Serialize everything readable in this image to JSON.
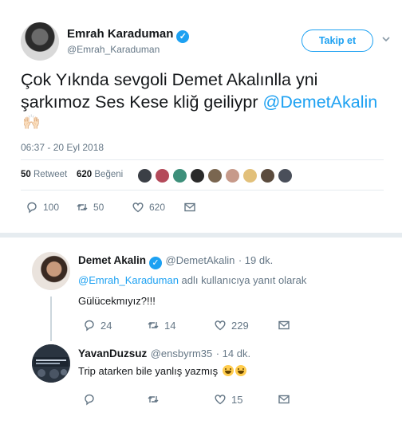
{
  "tweet": {
    "author_name": "Emrah Karaduman",
    "author_handle": "@Emrah_Karaduman",
    "follow_label": "Takip et",
    "text_line1": "Çok Yıknda sevgoli Demet Akalınlla yni",
    "text_line2": "şarkımoz Ses Kese kliğ geiliypr ",
    "mention": "@DemetAkalin",
    "emoji": "🙌🏻",
    "timestamp": "06:37 - 20 Eyl 2018",
    "retweet_count": "50",
    "retweet_label": "Retweet",
    "like_count": "620",
    "like_label": "Beğeni",
    "actions": {
      "replies": "100",
      "retweets": "50",
      "likes": "620"
    }
  },
  "replies": [
    {
      "name": "Demet Akalin",
      "handle": "@DemetAkalin",
      "time": "· 19 dk.",
      "reply_to_handle": "@Emrah_Karaduman",
      "reply_to_suffix": " adlı kullanıcıya yanıt olarak",
      "text": "Gülücekmıyız?!!!",
      "actions": {
        "retweets": "14",
        "likes": "229",
        "replies": "24"
      }
    },
    {
      "name": "YavanDuzsuz",
      "handle": "@ensbyrm35",
      "time": "· 14 dk.",
      "text": "Trip atarken bile yanlış yazmış",
      "actions": {
        "retweets": "",
        "likes": "15",
        "replies": ""
      }
    }
  ],
  "colors": {
    "accent": "#1da1f2",
    "muted": "#657786",
    "text": "#14171a",
    "divider": "#e6ecf0"
  },
  "icons": [
    "verified-badge-icon",
    "chevron-down-icon",
    "reply-icon",
    "retweet-icon",
    "like-icon",
    "message-icon"
  ]
}
